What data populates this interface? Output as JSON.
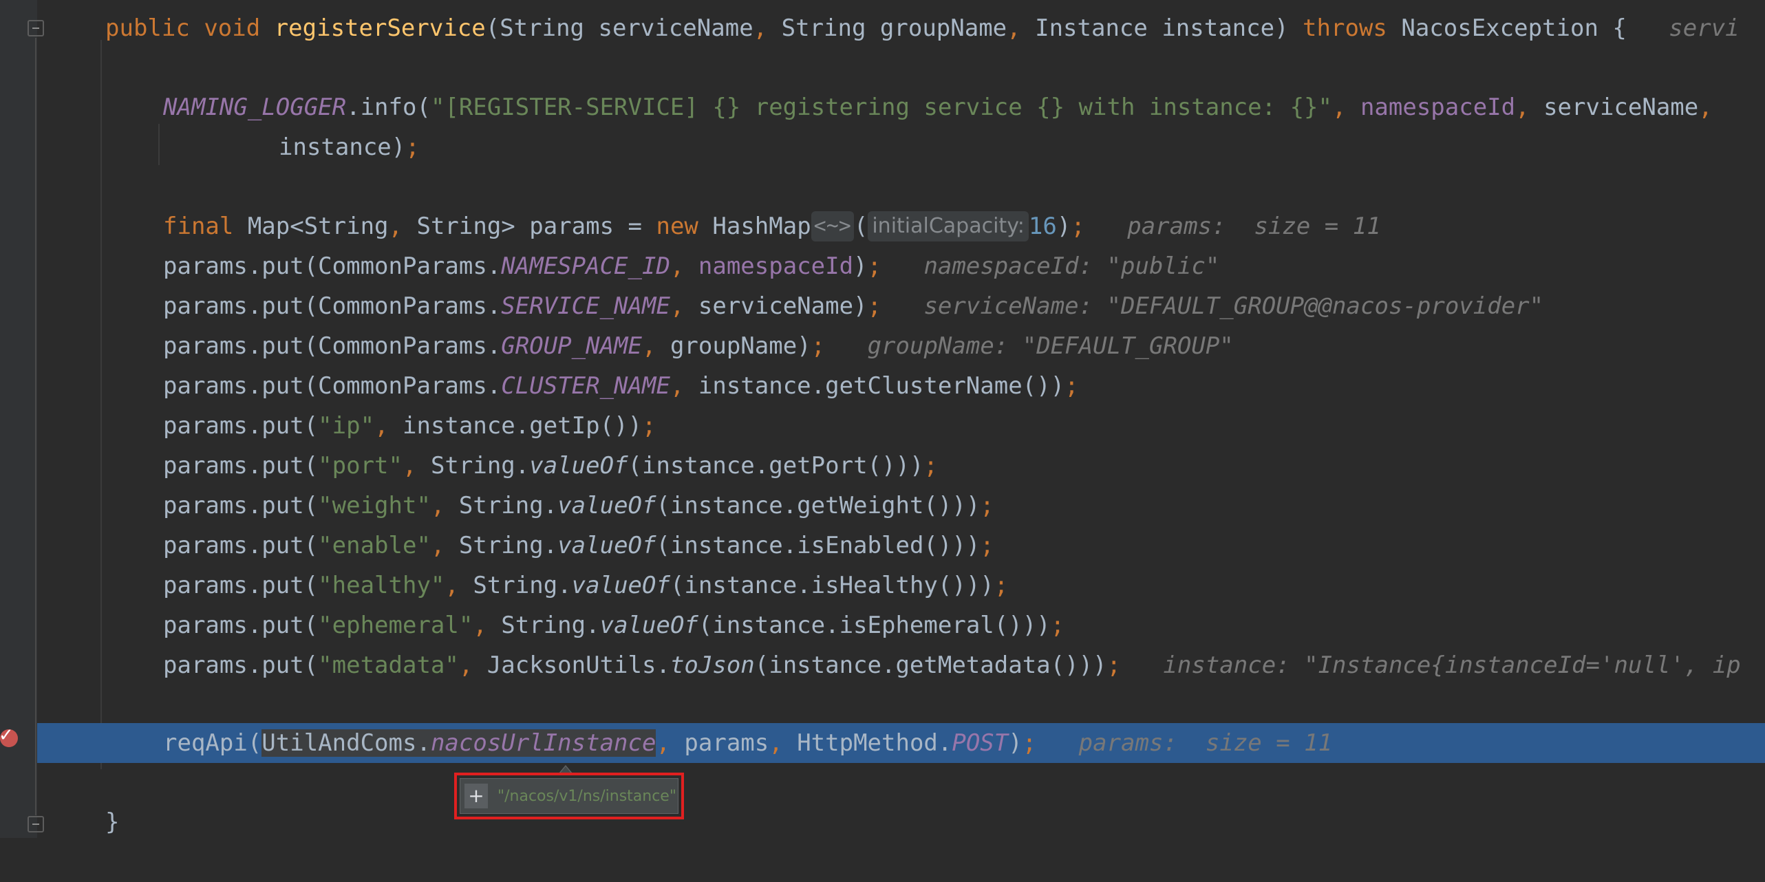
{
  "editor": {
    "method_signature": {
      "kw_public": "public",
      "kw_void": "void",
      "name": "registerService",
      "open": "(String serviceName",
      "comma1": ",",
      "p2": " String groupName",
      "comma2": ",",
      "p3": " Instance instance) ",
      "kw_throws": "throws",
      "rest": " NacosException {",
      "hint": "servi"
    },
    "log_line": {
      "field": "NAMING_LOGGER",
      "call": ".info(",
      "message": "\"[REGISTER-SERVICE] {} registering service {} with instance: {}\"",
      "comma1": ",",
      "arg1": " namespaceId",
      "comma2": ",",
      "arg2": " serviceName",
      "comma3": ","
    },
    "log_cont": {
      "arg": "instance)",
      "semi": ";"
    },
    "params_decl": {
      "kw_final": "final",
      "type": " Map<String",
      "comma": ",",
      "type2": " String> params = ",
      "kw_new": "new",
      "cls": " HashMap",
      "diamond": "<~>",
      "open": "(",
      "param_hint": "initialCapacity:",
      "num": "16",
      "close": ")",
      "semi": ";",
      "hint": "params:  size = 11"
    },
    "put_lines": [
      {
        "pre": "params.put(CommonParams.",
        "const": "NAMESPACE_ID",
        "comma": ",",
        "arg": " namespaceId",
        "ifield": true,
        "post": ")",
        "semi": ";",
        "hint": "namespaceId: \"public\""
      },
      {
        "pre": "params.put(CommonParams.",
        "const": "SERVICE_NAME",
        "comma": ",",
        "arg": " serviceName",
        "post": ")",
        "semi": ";",
        "hint": "serviceName: \"DEFAULT_GROUP@@nacos-provider\""
      },
      {
        "pre": "params.put(CommonParams.",
        "const": "GROUP_NAME",
        "comma": ",",
        "arg": " groupName",
        "post": ")",
        "semi": ";",
        "hint": "groupName: \"DEFAULT_GROUP\""
      },
      {
        "pre": "params.put(CommonParams.",
        "const": "CLUSTER_NAME",
        "comma": ",",
        "arg": " instance.getClusterName()",
        "post": ")",
        "semi": ";",
        "hint": ""
      }
    ],
    "str_puts": [
      {
        "pre": "params.put(",
        "key": "\"ip\"",
        "comma": ",",
        "mid": " instance.getIp()",
        "static": "",
        "post": ")",
        "semi": ";",
        "hint": ""
      },
      {
        "pre": "params.put(",
        "key": "\"port\"",
        "comma": ",",
        "mid": " String.",
        "static": "valueOf",
        "post": "(instance.getPort()))",
        "semi": ";",
        "hint": ""
      },
      {
        "pre": "params.put(",
        "key": "\"weight\"",
        "comma": ",",
        "mid": " String.",
        "static": "valueOf",
        "post": "(instance.getWeight()))",
        "semi": ";",
        "hint": ""
      },
      {
        "pre": "params.put(",
        "key": "\"enable\"",
        "comma": ",",
        "mid": " String.",
        "static": "valueOf",
        "post": "(instance.isEnabled()))",
        "semi": ";",
        "hint": ""
      },
      {
        "pre": "params.put(",
        "key": "\"healthy\"",
        "comma": ",",
        "mid": " String.",
        "static": "valueOf",
        "post": "(instance.isHealthy()))",
        "semi": ";",
        "hint": ""
      },
      {
        "pre": "params.put(",
        "key": "\"ephemeral\"",
        "comma": ",",
        "mid": " String.",
        "static": "valueOf",
        "post": "(instance.isEphemeral()))",
        "semi": ";",
        "hint": ""
      },
      {
        "pre": "params.put(",
        "key": "\"metadata\"",
        "comma": ",",
        "mid": " JacksonUtils.",
        "static": "toJson",
        "post": "(instance.getMetadata()))",
        "semi": ";",
        "hint": "instance: \"Instance{instanceId='null', ip"
      }
    ],
    "req_line": {
      "call": "reqApi(",
      "cls": "UtilAndComs.",
      "field": "nacosUrlInstance",
      "comma1": ",",
      "arg": " params",
      "comma2": ",",
      "cls2": " HttpMethod.",
      "const": "POST",
      "close": ")",
      "semi": ";",
      "hint": "params:  size = 11"
    },
    "closing_brace": "}"
  },
  "popup": {
    "plus": "+",
    "value": "\"/nacos/v1/ns/instance\""
  },
  "colors": {
    "background": "#2b2b2b",
    "current_line": "#2d5a8f",
    "keyword": "#cc7832",
    "string": "#6a8759",
    "field": "#9876aa",
    "breakpoint": "#c75450",
    "highlight_box": "#e02020"
  }
}
